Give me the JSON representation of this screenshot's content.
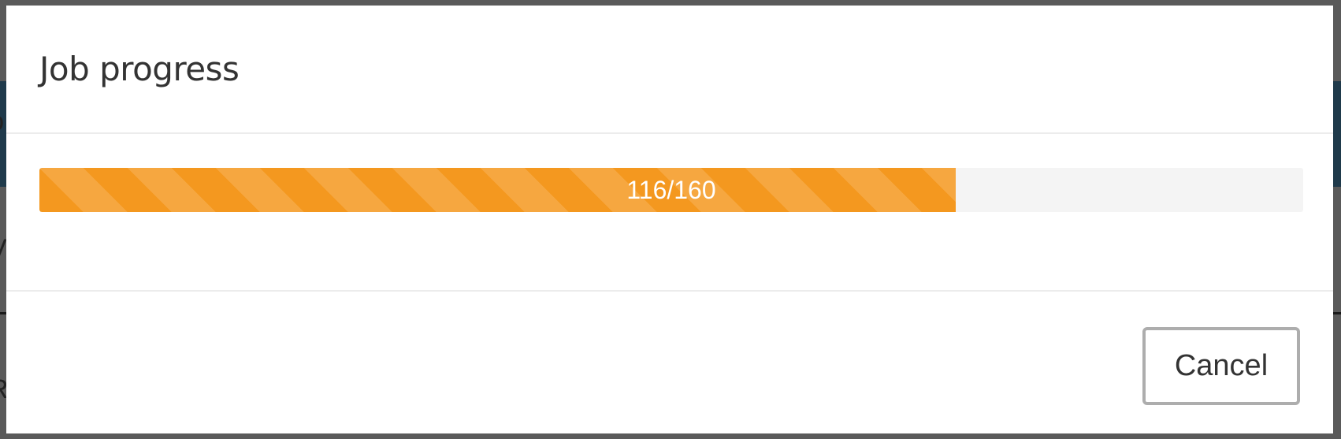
{
  "modal": {
    "title": "Job progress",
    "progress": {
      "completed": 116,
      "total": 160,
      "fraction": 0.725,
      "label": "116/160",
      "bar_color": "#f4981f",
      "track_color": "#f4f4f4"
    },
    "cancel_label": "Cancel"
  },
  "background": {
    "band_color": "#1f3a4b",
    "overlay_color": "#5a5a5a"
  }
}
